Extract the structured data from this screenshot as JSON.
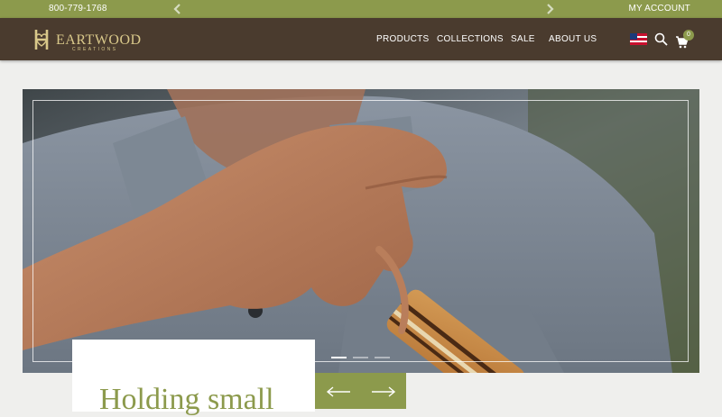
{
  "topbar": {
    "phone": "800-779-1768",
    "account": "MY ACCOUNT",
    "bg_color": "#8c9a4c"
  },
  "header": {
    "bg_color": "#4a3b2e",
    "logo": {
      "word": "EARTWOOD",
      "initial": "H",
      "sub": "CREATIONS",
      "color": "#d9c88a"
    },
    "nav": [
      "PRODUCTS",
      "COLLECTIONS",
      "SALE",
      "ABOUT US"
    ],
    "cart_count": "0"
  },
  "hero": {
    "caption_title": "Holding small",
    "active_slide": 1,
    "slide_count": 3
  },
  "accent_color": "#8c9a4c"
}
